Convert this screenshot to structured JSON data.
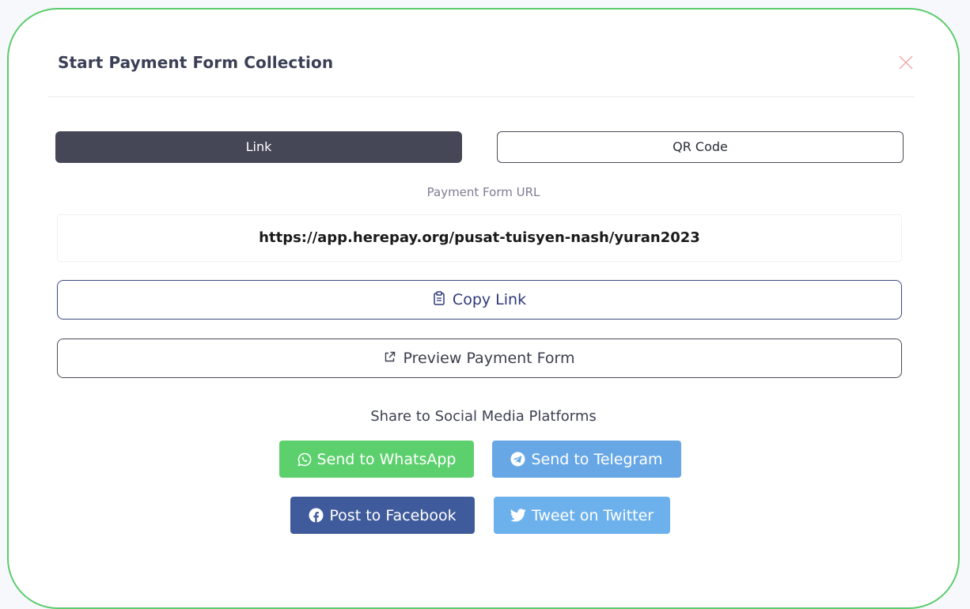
{
  "modal": {
    "title": "Start Payment Form Collection",
    "border_color": "#5ccc6c",
    "close_icon": "close-icon"
  },
  "tabs": [
    {
      "label": "Link",
      "active": true
    },
    {
      "label": "QR Code",
      "active": false
    }
  ],
  "url_section": {
    "label": "Payment Form URL",
    "url": "https://app.herepay.org/pusat-tuisyen-nash/yuran2023"
  },
  "buttons": {
    "copy_link": {
      "label": "Copy Link",
      "icon": "clipboard-icon"
    },
    "preview": {
      "label": "Preview Payment Form",
      "icon": "external-link-icon"
    }
  },
  "share": {
    "label": "Share to Social Media Platforms",
    "whatsapp": {
      "label": "Send to WhatsApp",
      "icon": "whatsapp-icon",
      "color": "#5dd06e"
    },
    "telegram": {
      "label": "Send to Telegram",
      "icon": "telegram-icon",
      "color": "#67a7e6"
    },
    "facebook": {
      "label": "Post to Facebook",
      "icon": "facebook-icon",
      "color": "#3f5b9b"
    },
    "twitter": {
      "label": "Tweet on Twitter",
      "icon": "twitter-icon",
      "color": "#6cb1ec"
    }
  }
}
